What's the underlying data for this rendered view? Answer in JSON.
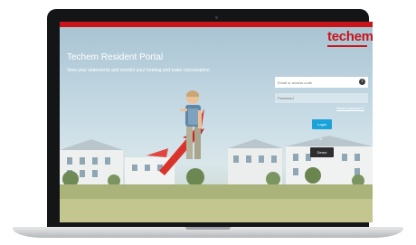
{
  "header": {
    "logo": "techem",
    "accent_color": "#c9141a"
  },
  "portal": {
    "title": "Techem Resident Portal",
    "subtitle": "View your statements and monitor your heating and water consumption."
  },
  "login": {
    "email_placeholder": "Email or access code",
    "password_placeholder": "Password",
    "reset_link": "Reset password?",
    "login_label": "Login",
    "or_label": "or",
    "demo_label": "Demo",
    "login_color": "#1aa3d9",
    "field_icon": "info-icon"
  }
}
